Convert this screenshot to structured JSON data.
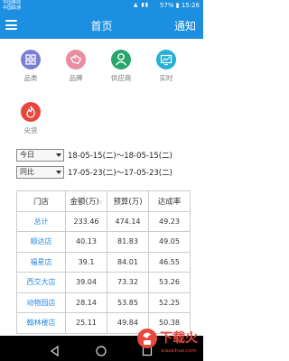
{
  "status_bar": {
    "carrier1": "中国移动",
    "carrier2": "中国联通",
    "battery": "57%",
    "time": "15:26"
  },
  "nav": {
    "title": "首页",
    "action": "通知"
  },
  "grid": [
    {
      "label": "品类",
      "icon": "category-icon",
      "color": "#7a7fd6"
    },
    {
      "label": "品牌",
      "icon": "tag-icon",
      "color": "#e98da1"
    },
    {
      "label": "供应商",
      "icon": "supplier-icon",
      "color": "#2aa66c"
    },
    {
      "label": "实时",
      "icon": "realtime-chart-icon",
      "color": "#27b0d6"
    },
    {
      "label": "尖货",
      "icon": "flame-icon",
      "color": "#e8473c"
    }
  ],
  "filters": [
    {
      "selected": "今日",
      "range": "18-05-15(二)～18-05-15(二)"
    },
    {
      "selected": "同比",
      "range": "17-05-23(二)～17-05-23(二)"
    }
  ],
  "table": {
    "headers": [
      "门店",
      "金额(万)",
      "预算(万)",
      "达成率"
    ],
    "rows": [
      [
        "总计",
        "233.46",
        "474.14",
        "49.23"
      ],
      [
        "顺达店",
        "40.13",
        "81.83",
        "49.05"
      ],
      [
        "福星店",
        "39.1",
        "84.01",
        "46.55"
      ],
      [
        "西交大店",
        "39.04",
        "73.32",
        "53.26"
      ],
      [
        "动物园店",
        "28.14",
        "53.85",
        "52.25"
      ],
      [
        "翰林楼店",
        "25.11",
        "49.84",
        "50.38"
      ]
    ]
  },
  "watermark": {
    "text": "下载火",
    "url": "xiazaihuo.com"
  }
}
